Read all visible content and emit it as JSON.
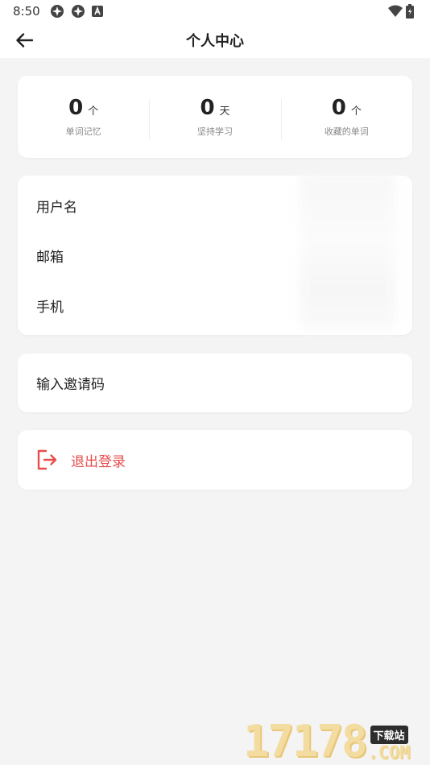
{
  "status_bar": {
    "time": "8:50",
    "left_icons": [
      "settings-icon",
      "settings-icon",
      "a-notification-icon"
    ],
    "right_icons": [
      "wifi-icon",
      "battery-icon"
    ]
  },
  "app_bar": {
    "title": "个人中心",
    "back_icon": "back-arrow-icon"
  },
  "stats": [
    {
      "value": "0",
      "unit": "个",
      "label": "单词记忆"
    },
    {
      "value": "0",
      "unit": "天",
      "label": "坚持学习"
    },
    {
      "value": "0",
      "unit": "个",
      "label": "收藏的单词"
    }
  ],
  "info_rows": [
    {
      "label": "用户名"
    },
    {
      "label": "邮箱"
    },
    {
      "label": "手机"
    }
  ],
  "invite": {
    "label": "输入邀请码"
  },
  "logout": {
    "label": "退出登录",
    "icon": "logout-icon",
    "color": "#e84c4c"
  },
  "watermark": {
    "digits": "17178",
    "tag": "下载站",
    "suffix": ".COM"
  },
  "colors": {
    "background": "#f4f4f5",
    "card": "#ffffff",
    "danger": "#e84c4c",
    "watermark": "#f3dca0"
  }
}
